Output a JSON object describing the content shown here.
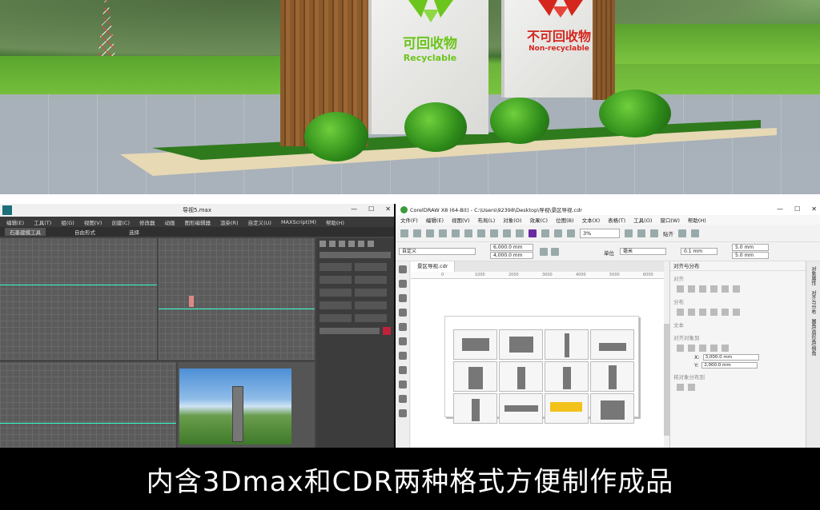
{
  "scene": {
    "recyclable_cn": "可回收物",
    "recyclable_en": "Recyclable",
    "nonrecyclable_cn": "不可回收物",
    "nonrecyclable_en": "Non-recyclable",
    "recyclable_color": "#6cc51c",
    "nonrecyclable_color": "#d5261d"
  },
  "max": {
    "title": "导视5.max",
    "window_controls": [
      "—",
      "☐",
      "✕"
    ],
    "menu": [
      "编辑(E)",
      "工具(T)",
      "组(G)",
      "视图(V)",
      "创建(C)",
      "修改器",
      "动画",
      "图形编辑器",
      "渲染(R)",
      "自定义(U)",
      "MAXScript(M)",
      "帮助(H)"
    ],
    "ribbon_tabs": [
      "石墨建模工具",
      "自由形式",
      "选择"
    ]
  },
  "cdr": {
    "title": "CorelDRAW X8 (64-Bit) - C:\\Users\\92398\\Desktop\\导视\\景区导视.cdr",
    "window_controls": [
      "—",
      "☐",
      "✕"
    ],
    "menu": [
      "文件(F)",
      "编辑(E)",
      "视图(V)",
      "布局(L)",
      "对象(O)",
      "效果(C)",
      "位图(B)",
      "文本(X)",
      "表格(T)",
      "工具(O)",
      "窗口(W)",
      "帮助(H)"
    ],
    "zoom": "3%",
    "snap_label": "贴齐",
    "preset": "自定义",
    "width": "6,000.0 mm",
    "height": "4,000.0 mm",
    "unit_label": "单位",
    "unit": "毫米",
    "nudge": "0.1 mm",
    "dup_x": "5.0 mm",
    "dup_y": "5.0 mm",
    "doc_tab": "景区导视.cdr",
    "ruler_ticks": [
      "0",
      "1000",
      "2000",
      "3000",
      "4000",
      "5000",
      "6000"
    ],
    "docker": {
      "title": "对齐与分布",
      "align": "对齐",
      "distribute": "分布",
      "text": "文本",
      "align_to": "对齐对象到",
      "x_label": "X:",
      "x_value": "3,000.0 mm",
      "y_label": "Y:",
      "y_value": "2,000.0 mm",
      "distribute_to": "将对象分布到"
    },
    "side_tabs": [
      "对象属性",
      "对齐与分布",
      "圆角/扇形角/倒角"
    ]
  },
  "caption": "内含3Dmax和CDR两种格式方便制作成品"
}
